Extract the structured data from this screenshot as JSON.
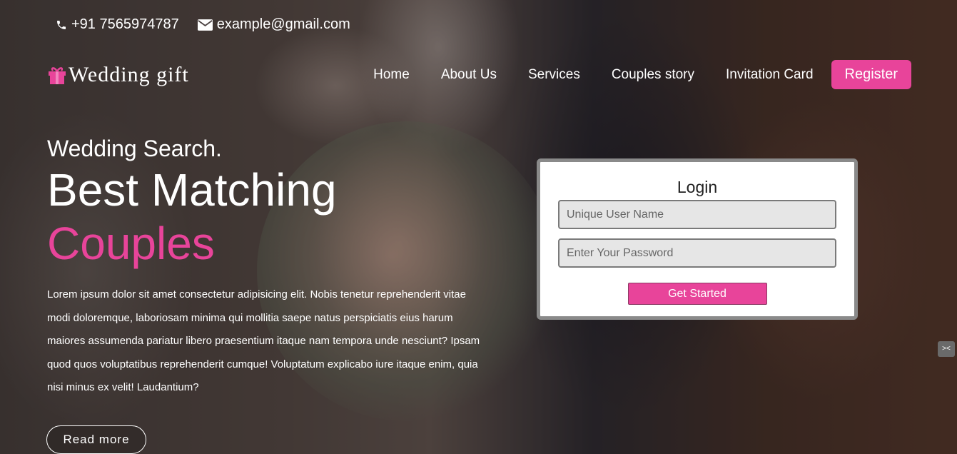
{
  "contact": {
    "phone": "+91 7565974787",
    "email": "example@gmail.com"
  },
  "brand": {
    "name": "Wedding gift",
    "accent": "#e8449a"
  },
  "nav": {
    "items": [
      "Home",
      "About Us",
      "Services",
      "Couples story",
      "Invitation Card"
    ],
    "register": "Register"
  },
  "hero": {
    "kicker": "Wedding Search.",
    "title": "Best Matching",
    "title_highlight": "Couples",
    "description": "Lorem ipsum dolor sit amet consectetur adipisicing elit. Nobis tenetur reprehenderit vitae modi doloremque, laboriosam minima qui mollitia saepe natus perspiciatis eius harum maiores assumenda pariatur libero praesentium itaque nam tempora unde nesciunt? Ipsam quod quos voluptatibus reprehenderit cumque! Voluptatum explicabo iure itaque enim, quia nisi minus ex velit! Laudantium?",
    "read_more": "Read more"
  },
  "login": {
    "title": "Login",
    "username_placeholder": "Unique User Name",
    "password_placeholder": "Enter Your Password",
    "submit": "Get Started"
  }
}
